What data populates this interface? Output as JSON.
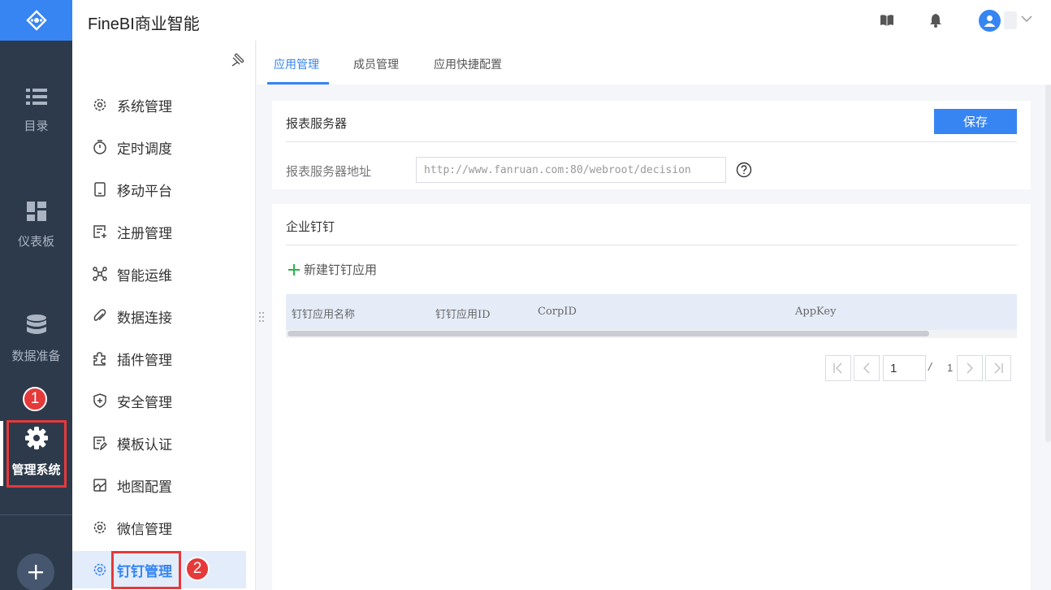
{
  "app": {
    "title": "FineBI商业智能"
  },
  "rail": {
    "items": [
      {
        "label": "目录",
        "icon": "list-icon"
      },
      {
        "label": "仪表板",
        "icon": "dashboard-icon"
      },
      {
        "label": "数据准备",
        "icon": "database-icon"
      },
      {
        "label": "管理系统",
        "icon": "gear-icon"
      }
    ],
    "add_icon": "plus-icon"
  },
  "annotations": {
    "badge_1": "1",
    "badge_2": "2",
    "color": "#e5393a"
  },
  "sidebar": {
    "items": [
      {
        "label": "系统管理",
        "icon": "gear-icon"
      },
      {
        "label": "定时调度",
        "icon": "timer-icon"
      },
      {
        "label": "移动平台",
        "icon": "mobile-icon"
      },
      {
        "label": "注册管理",
        "icon": "register-icon"
      },
      {
        "label": "智能运维",
        "icon": "network-icon"
      },
      {
        "label": "数据连接",
        "icon": "paperclip-icon"
      },
      {
        "label": "插件管理",
        "icon": "puzzle-icon"
      },
      {
        "label": "安全管理",
        "icon": "shield-icon"
      },
      {
        "label": "模板认证",
        "icon": "template-icon"
      },
      {
        "label": "地图配置",
        "icon": "map-icon"
      },
      {
        "label": "微信管理",
        "icon": "gear-icon"
      },
      {
        "label": "钉钉管理",
        "icon": "gear-icon",
        "active": true
      }
    ]
  },
  "tabs": [
    "应用管理",
    "成员管理",
    "应用快捷配置"
  ],
  "report_server": {
    "title": "报表服务器",
    "save_label": "保存",
    "address_label": "报表服务器地址",
    "address_placeholder": "http://www.fanruan.com:80/webroot/decision"
  },
  "dingtalk": {
    "title": "企业钉钉",
    "new_app_label": "新建钉钉应用",
    "columns": [
      "钉钉应用名称",
      "钉钉应用ID",
      "CorpID",
      "AppKey"
    ]
  },
  "pagination": {
    "current": "1",
    "separator": "/",
    "total": "1"
  },
  "colors": {
    "accent": "#3685f2",
    "rail_bg": "#2d3a4b",
    "add_green": "#2bb24c"
  }
}
